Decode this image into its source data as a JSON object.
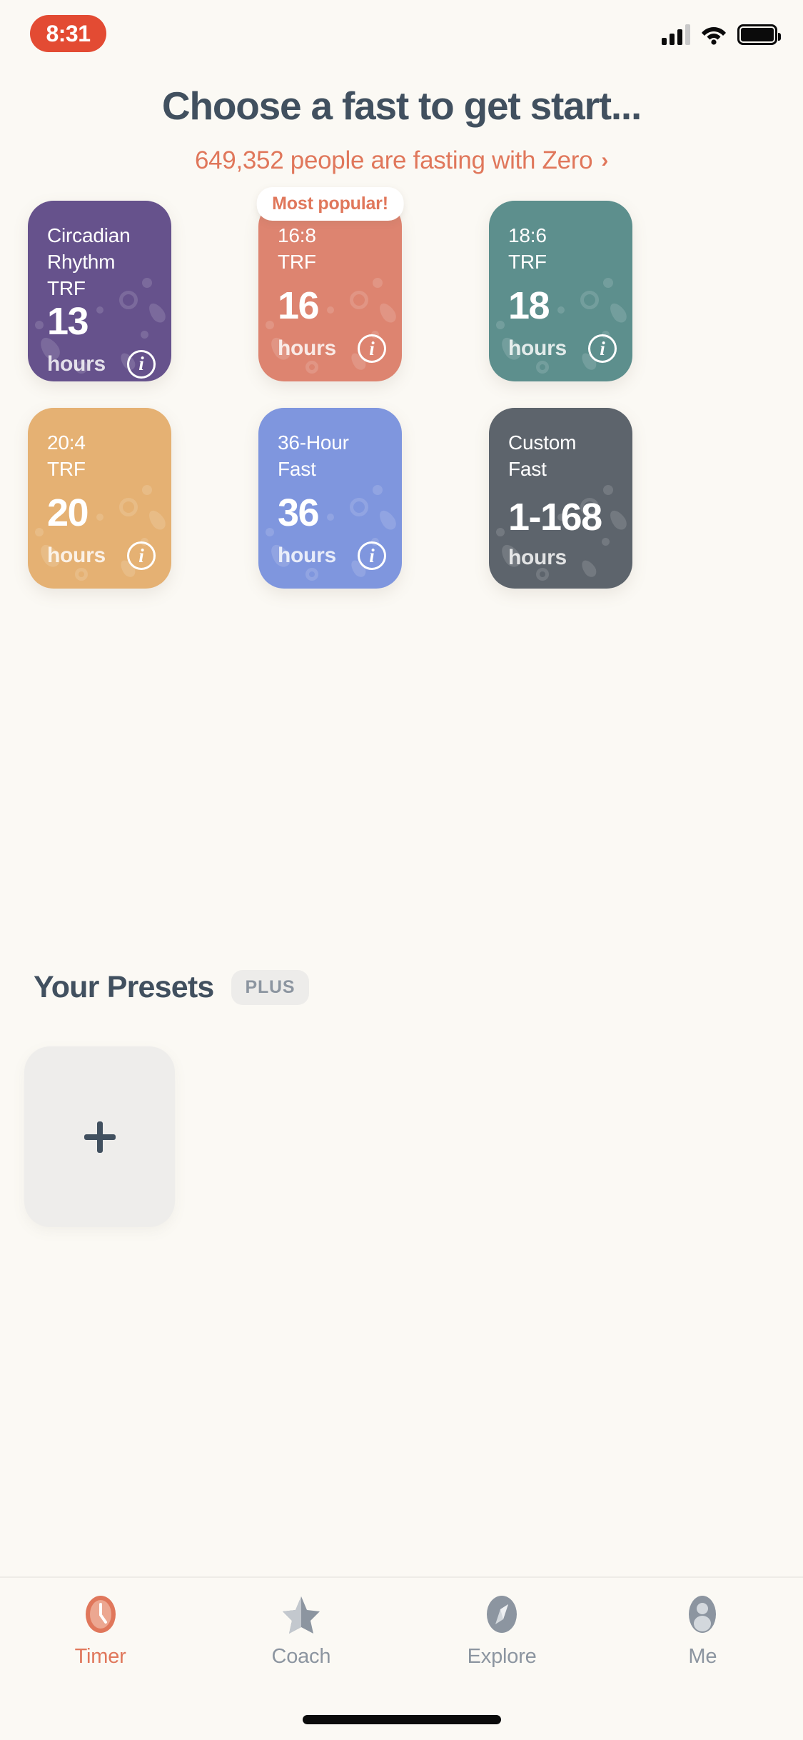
{
  "status_bar": {
    "time": "8:31",
    "icons": [
      "cellular-signal-icon",
      "wifi-icon",
      "battery-icon"
    ]
  },
  "header": {
    "title": "Choose a fast to get start...",
    "subtitle": "649,352 people are fasting with Zero",
    "subtitle_chevron": "›",
    "fasting_people_count": "649,352"
  },
  "fast_cards": [
    {
      "name_line1": "Circadian",
      "name_line2": "Rhythm TRF",
      "duration": "13",
      "unit": "hours",
      "color": "#66528c",
      "has_info": true,
      "badge": null
    },
    {
      "name_line1": "16:8",
      "name_line2": "TRF",
      "duration": "16",
      "unit": "hours",
      "color": "#dd8470",
      "has_info": true,
      "badge": "Most popular!"
    },
    {
      "name_line1": "18:6",
      "name_line2": "TRF",
      "duration": "18",
      "unit": "hours",
      "color": "#5d8f8d",
      "has_info": true,
      "badge": null
    },
    {
      "name_line1": "20:4",
      "name_line2": "TRF",
      "duration": "20",
      "unit": "hours",
      "color": "#e5b173",
      "has_info": true,
      "badge": null
    },
    {
      "name_line1": "36-Hour",
      "name_line2": "Fast",
      "duration": "36",
      "unit": "hours",
      "color": "#7f96de",
      "has_info": true,
      "badge": null
    },
    {
      "name_line1": "Custom",
      "name_line2": "Fast",
      "duration": "1-168",
      "unit": "hours",
      "color": "#5d646c",
      "has_info": false,
      "badge": null
    }
  ],
  "presets": {
    "title": "Your Presets",
    "plus_badge": "PLUS",
    "add_icon": "plus-icon"
  },
  "tab_bar": {
    "items": [
      {
        "label": "Timer",
        "icon": "timer-icon",
        "active": true
      },
      {
        "label": "Coach",
        "icon": "star-icon",
        "active": false
      },
      {
        "label": "Explore",
        "icon": "compass-icon",
        "active": false
      },
      {
        "label": "Me",
        "icon": "person-icon",
        "active": false
      }
    ]
  },
  "colors": {
    "background": "#fbf9f4",
    "accent": "#e0775b",
    "text_dark": "#41505f",
    "text_muted": "#8c95a0"
  }
}
